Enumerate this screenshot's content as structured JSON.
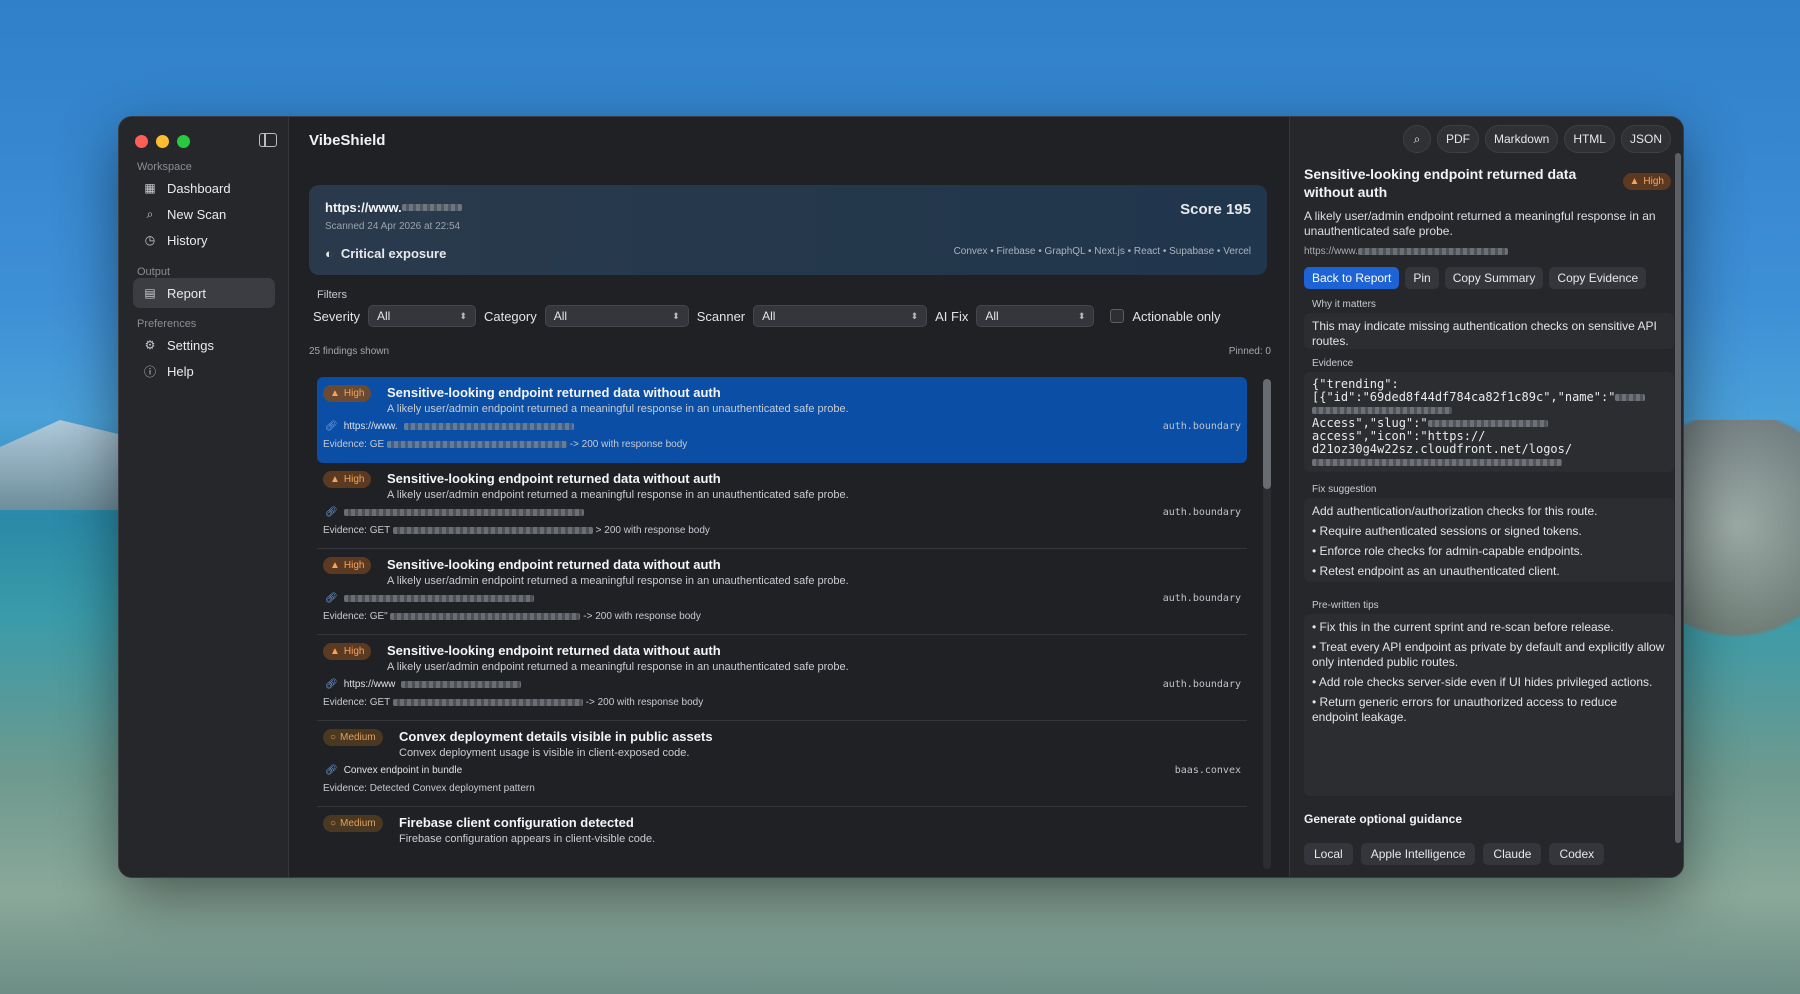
{
  "app": {
    "title": "VibeShield"
  },
  "sidebar": {
    "sections": [
      {
        "label": "Workspace"
      },
      {
        "label": "Output"
      },
      {
        "label": "Preferences"
      }
    ],
    "items": [
      {
        "label": "Dashboard",
        "icon": "grid-icon"
      },
      {
        "label": "New Scan",
        "icon": "search-icon"
      },
      {
        "label": "History",
        "icon": "clock-icon"
      },
      {
        "label": "Report",
        "icon": "document-icon",
        "active": true
      },
      {
        "label": "Settings",
        "icon": "gear-icon"
      },
      {
        "label": "Help",
        "icon": "question-icon"
      }
    ]
  },
  "summary": {
    "url": "https://www.",
    "date": "Scanned 24 Apr 2026 at 22:54",
    "exposure": "Critical exposure",
    "score": "Score 195",
    "stack": "Convex • Firebase • GraphQL • Next.js • React • Supabase • Vercel"
  },
  "filters": {
    "label": "Filters",
    "severity_label": "Severity",
    "severity_value": "All",
    "category_label": "Category",
    "category_value": "All",
    "scanner_label": "Scanner",
    "scanner_value": "All",
    "aifix_label": "AI Fix",
    "aifix_value": "All",
    "actionable_label": "Actionable only"
  },
  "list_meta": {
    "count": "25 findings shown",
    "pinned": "Pinned: 0"
  },
  "findings": [
    {
      "severity": "High",
      "title": "Sensitive-looking endpoint returned data without auth",
      "desc": "A likely user/admin endpoint returned a meaningful response in an unauthenticated safe probe.",
      "url": "https://www.",
      "evidence_prefix": "Evidence: GE",
      "evidence_suffix": "-> 200 with response body",
      "tag": "auth.boundary"
    },
    {
      "severity": "High",
      "title": "Sensitive-looking endpoint returned data without auth",
      "desc": "A likely user/admin endpoint returned a meaningful response in an unauthenticated safe probe.",
      "url": "",
      "evidence_prefix": "Evidence: GET",
      "evidence_suffix": "> 200 with response body",
      "tag": "auth.boundary"
    },
    {
      "severity": "High",
      "title": "Sensitive-looking endpoint returned data without auth",
      "desc": "A likely user/admin endpoint returned a meaningful response in an unauthenticated safe probe.",
      "url": "",
      "evidence_prefix": "Evidence: GE\"",
      "evidence_suffix": "-> 200 with response body",
      "tag": "auth.boundary"
    },
    {
      "severity": "High",
      "title": "Sensitive-looking endpoint returned data without auth",
      "desc": "A likely user/admin endpoint returned a meaningful response in an unauthenticated safe probe.",
      "url": "https://www",
      "evidence_prefix": "Evidence: GET",
      "evidence_suffix": "-> 200 with response body",
      "tag": "auth.boundary"
    },
    {
      "severity": "Medium",
      "title": "Convex deployment details visible in public assets",
      "desc": "Convex deployment usage is visible in client-exposed code.",
      "url": "Convex endpoint in bundle",
      "evidence_prefix": "Evidence: Detected Convex deployment pattern",
      "evidence_suffix": "",
      "tag": "baas.convex"
    },
    {
      "severity": "Medium",
      "title": "Firebase client configuration detected",
      "desc": "Firebase configuration appears in client-visible code.",
      "url": "",
      "evidence_prefix": "",
      "evidence_suffix": "",
      "tag": ""
    }
  ],
  "toolbar": {
    "pdf": "PDF",
    "markdown": "Markdown",
    "html": "HTML",
    "json": "JSON"
  },
  "detail": {
    "title": "Sensitive-looking endpoint returned data without auth",
    "severity": "High",
    "desc": "A likely user/admin endpoint returned a meaningful response in an unauthenticated safe probe.",
    "url": "https://www.",
    "actions": {
      "back": "Back to Report",
      "pin": "Pin",
      "copy_summary": "Copy Summary",
      "copy_evidence": "Copy Evidence"
    },
    "why_label": "Why it matters",
    "why_text": "This may indicate missing authentication checks on sensitive API routes.",
    "evidence_label": "Evidence",
    "evidence_lines": [
      "{\"trending\":",
      "[{\"id\":\"69ded8f44df784ca82f1c89c\",\"name\":\"",
      "Access\",\"slug\":\"",
      "access\",\"icon\":\"https://",
      "d21oz30g4w22sz.cloudfront.net/logos/"
    ],
    "fix_label": "Fix suggestion",
    "fix_main": "Add authentication/authorization checks for this route.",
    "fix_items": [
      "• Require authenticated sessions or signed tokens.",
      "• Enforce role checks for admin-capable endpoints.",
      "• Retest endpoint as an unauthenticated client."
    ],
    "tips_label": "Pre-written tips",
    "tips": [
      "• Fix this in the current sprint and re-scan before release.",
      "• Treat every API endpoint as private by default and explicitly allow only intended public routes.",
      "• Add role checks server-side even if UI hides privileged actions.",
      "• Return generic errors for unauthorized access to reduce endpoint leakage."
    ],
    "guidance_title": "Generate optional guidance",
    "guidance_options": [
      "Local",
      "Apple Intelligence",
      "Claude",
      "Codex"
    ]
  }
}
